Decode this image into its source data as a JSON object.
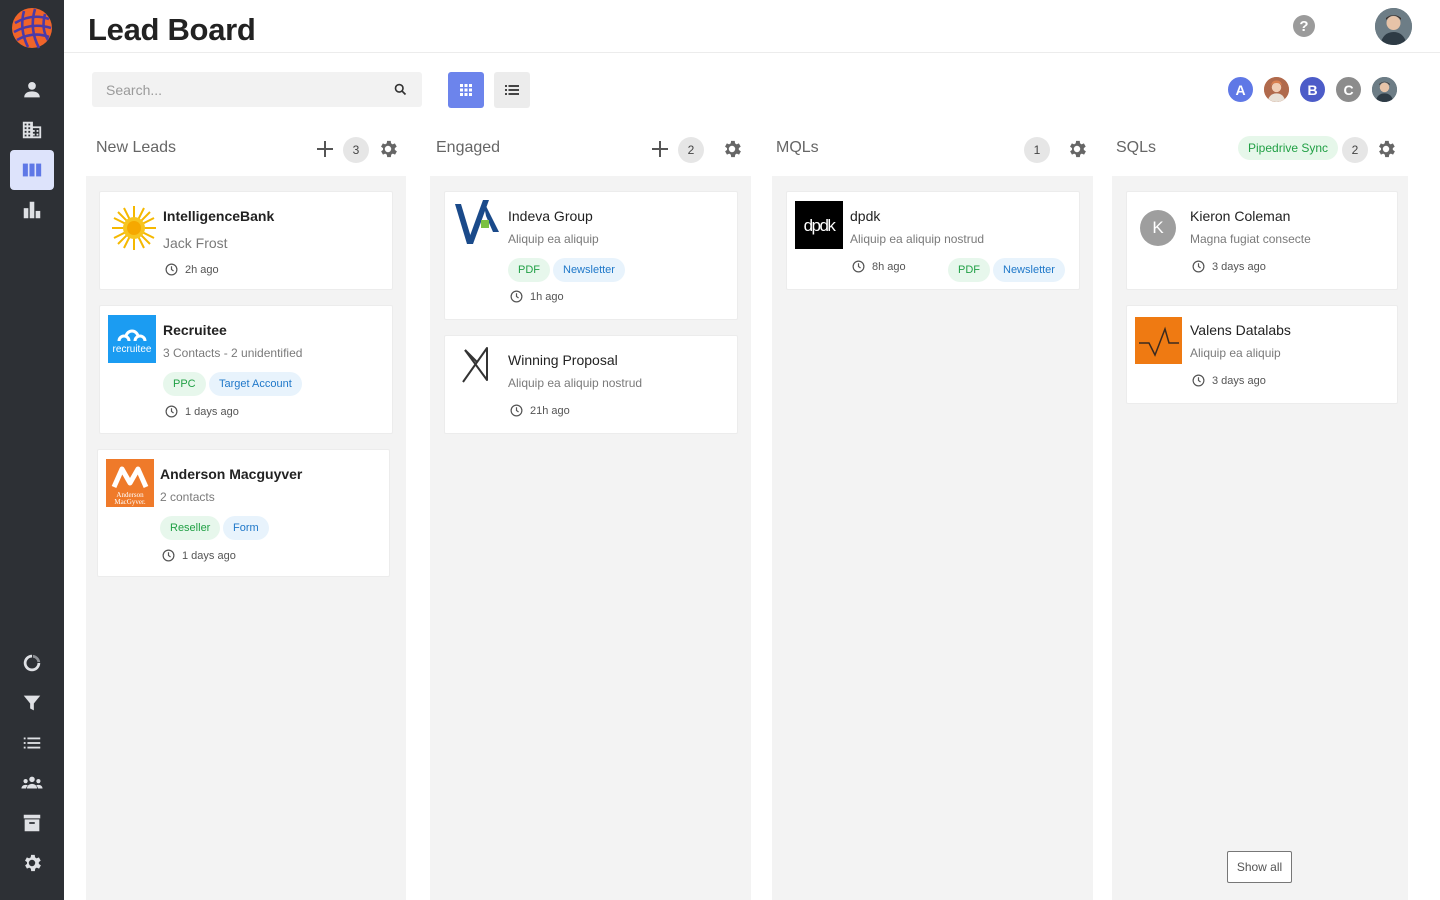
{
  "app": {
    "title": "Lead Board",
    "brand_color": "#5f78e6"
  },
  "sidebar": {
    "top_items": [
      {
        "icon": "person-icon",
        "label": "Contacts"
      },
      {
        "icon": "building-icon",
        "label": "Companies"
      },
      {
        "icon": "board-icon",
        "label": "Lead Board",
        "active": true
      },
      {
        "icon": "bar-chart-icon",
        "label": "Reports"
      }
    ],
    "bottom_items": [
      {
        "icon": "sync-icon"
      },
      {
        "icon": "filter-icon"
      },
      {
        "icon": "list-icon"
      },
      {
        "icon": "team-icon"
      },
      {
        "icon": "archive-icon"
      },
      {
        "icon": "gear-icon"
      }
    ]
  },
  "header": {
    "help": "?"
  },
  "toolbar": {
    "search_placeholder": "Search..."
  },
  "team": [
    {
      "initial": "A",
      "color": "#5f78e6"
    },
    {
      "initial": "",
      "color": "#c9856b",
      "photo": true
    },
    {
      "initial": "B",
      "color": "#4c5cc8"
    },
    {
      "initial": "C",
      "color": "#8c8c8c"
    },
    {
      "initial": "",
      "color": "#556670",
      "photo": true
    }
  ],
  "columns": [
    {
      "title": "New Leads",
      "count": "3",
      "cards": [
        {
          "name": "IntelligenceBank",
          "sub": "Jack Frost",
          "time": "2h ago",
          "tags": []
        },
        {
          "name": "Recruitee",
          "sub": "3 Contacts - 2 unidentified",
          "time": "1 days ago",
          "tags": [
            "PPC",
            "Target Account"
          ],
          "logo_text": "recruitee"
        },
        {
          "name": "Anderson Macguyver",
          "sub": "2 contacts",
          "time": "1 days ago",
          "tags": [
            "Reseller",
            "Form"
          ],
          "logo_text": "Anderson MacGyver"
        }
      ]
    },
    {
      "title": "Engaged",
      "count": "2",
      "cards": [
        {
          "name": "Indeva Group",
          "sub": "Aliquip ea aliquip",
          "time": "1h ago",
          "tags": [
            "PDF",
            "Newsletter"
          ]
        },
        {
          "name": "Winning Proposal",
          "sub": "Aliquip ea aliquip nostrud",
          "time": "21h ago",
          "tags": []
        }
      ]
    },
    {
      "title": "MQLs",
      "count": "1",
      "cards": [
        {
          "name": "dpdk",
          "sub": "Aliquip ea aliquip nostrud",
          "time": "8h ago",
          "tags": [
            "PDF",
            "Newsletter"
          ],
          "logo_text": "dpdk"
        }
      ]
    },
    {
      "title": "SQLs",
      "count": "2",
      "badge": "Pipedrive Sync",
      "cards": [
        {
          "name": "Kieron Coleman",
          "sub": "Magna fugiat consecte",
          "time": "3 days ago",
          "tags": [],
          "initial": "K"
        },
        {
          "name": "Valens Datalabs",
          "sub": "Aliquip ea aliquip",
          "time": "3 days ago",
          "tags": []
        }
      ],
      "show_all": "Show all"
    }
  ]
}
